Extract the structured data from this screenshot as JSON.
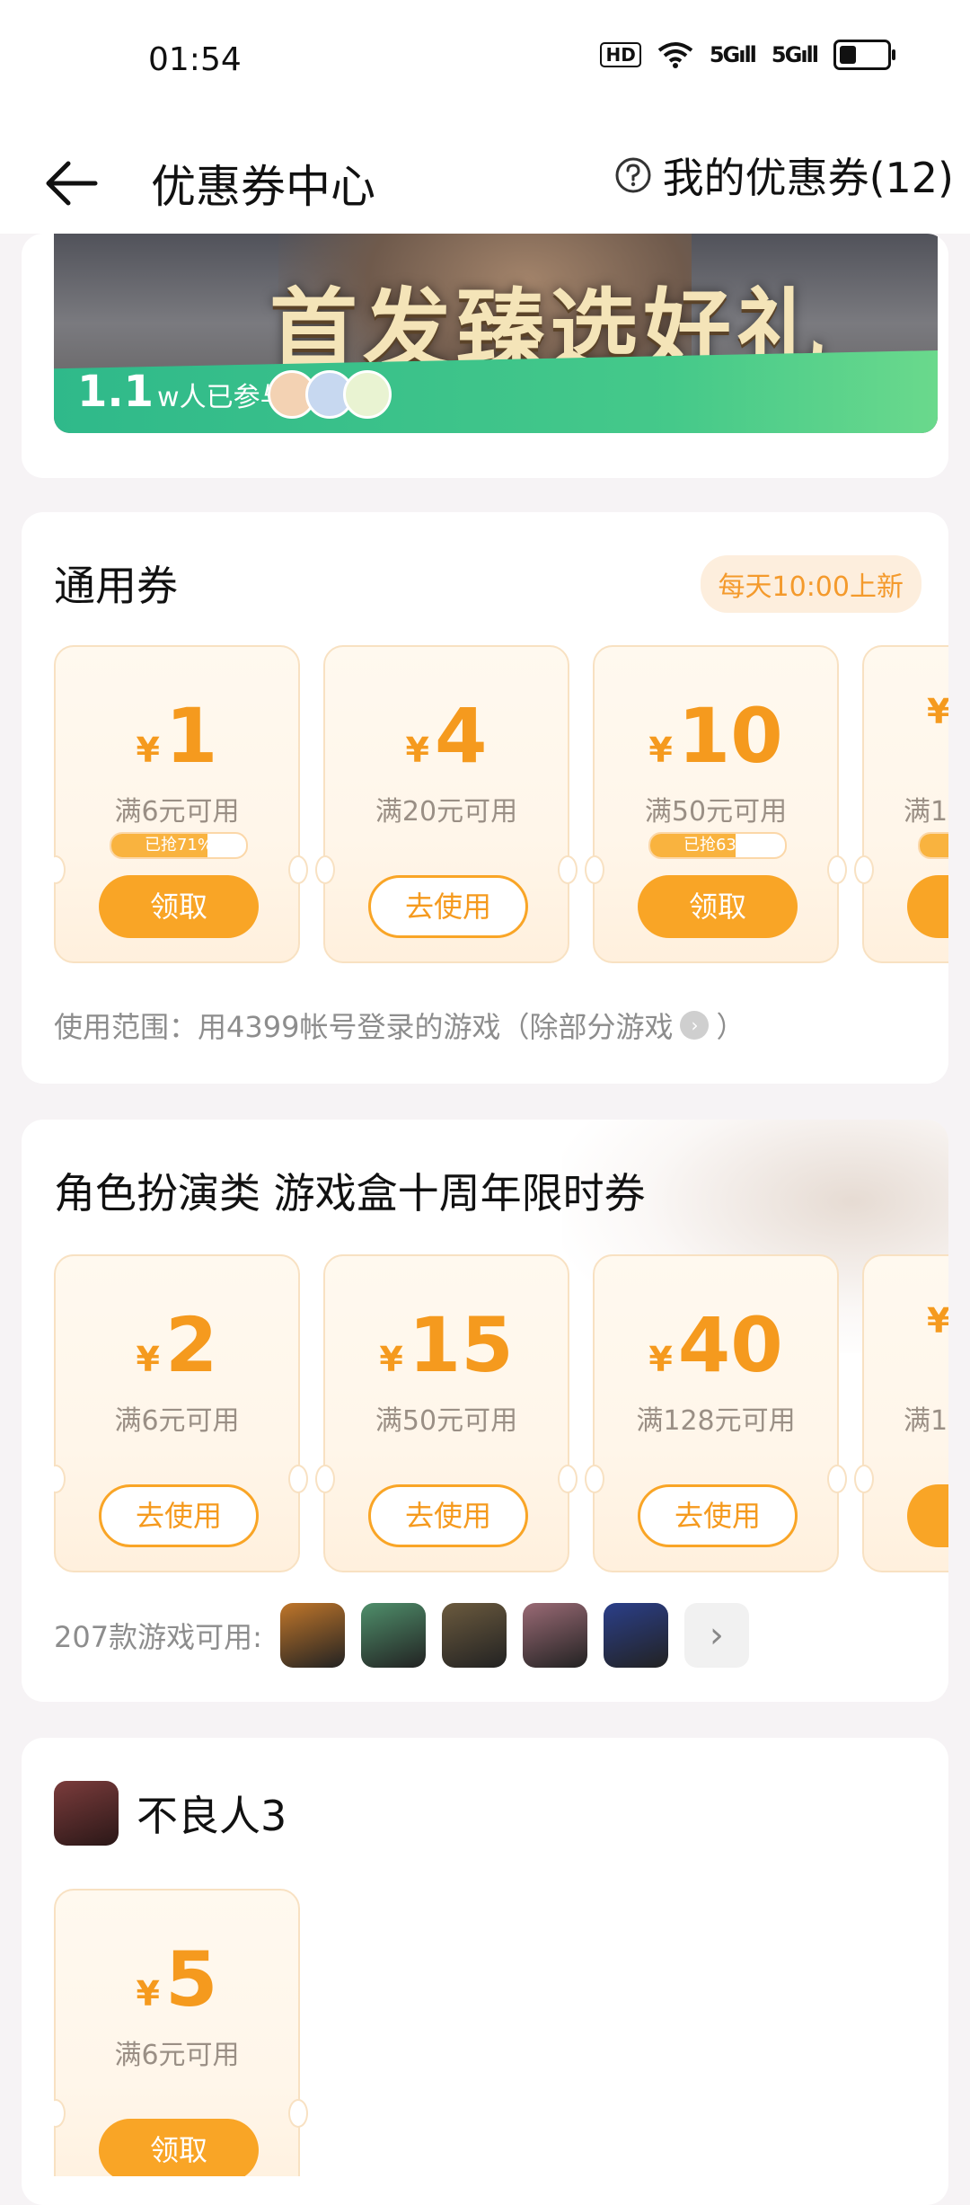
{
  "status": {
    "time": "01:54",
    "hd_label": "HD",
    "signal1": "5G",
    "signal2": "5G",
    "battery_level": 0.35
  },
  "nav": {
    "title": "优惠券中心",
    "my_coupons_label": "我的优惠券(12)"
  },
  "banner": {
    "title": "首发臻选好礼",
    "participants_num": "1.1",
    "participants_text": "w人已参与"
  },
  "general": {
    "title": "通用券",
    "tag": "每天10:00上新",
    "coupons": [
      {
        "yen": "¥",
        "value": "1",
        "condition": "满6元可用",
        "progress_text": "已抢71%",
        "progress": 0.71,
        "button": "领取",
        "button_style": "primary"
      },
      {
        "yen": "¥",
        "value": "4",
        "condition": "满20元可用",
        "button": "去使用",
        "button_style": "outline"
      },
      {
        "yen": "¥",
        "value": "10",
        "condition": "满50元可用",
        "progress_text": "已抢63%",
        "progress": 0.63,
        "button": "领取",
        "button_style": "primary"
      },
      {
        "yen": "¥",
        "value": "",
        "condition": "满1",
        "progress": 0.5,
        "button": "",
        "button_style": "primary"
      }
    ],
    "scope_text": "使用范围：用4399帐号登录的游戏（除部分游戏",
    "scope_end": "）"
  },
  "rpg": {
    "title": "角色扮演类 游戏盒十周年限时券",
    "coupons": [
      {
        "yen": "¥",
        "value": "2",
        "condition": "满6元可用",
        "button": "去使用"
      },
      {
        "yen": "¥",
        "value": "15",
        "condition": "满50元可用",
        "button": "去使用"
      },
      {
        "yen": "¥",
        "value": "40",
        "condition": "满128元可用",
        "button": "去使用"
      },
      {
        "yen": "¥",
        "value": "",
        "condition": "满1",
        "button": ""
      }
    ],
    "games_label": "207款游戏可用:",
    "game_icon_colors": [
      "#c0762a",
      "#4f8f6b",
      "#6b5a3e",
      "#9a6a75",
      "#2b3f8a"
    ]
  },
  "game_section": {
    "name": "不良人3",
    "coupon": {
      "yen": "¥",
      "value": "5",
      "condition": "满6元可用",
      "button": "领取"
    }
  }
}
